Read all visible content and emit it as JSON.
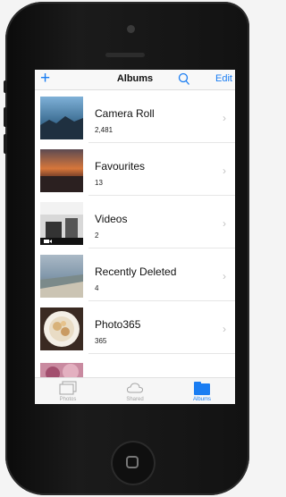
{
  "nav": {
    "add_icon": "plus-icon",
    "title": "Albums",
    "search_icon": "search-icon",
    "edit_label": "Edit"
  },
  "albums": [
    {
      "title": "Camera Roll",
      "count": "2,481"
    },
    {
      "title": "Favourites",
      "count": "13"
    },
    {
      "title": "Videos",
      "count": "2"
    },
    {
      "title": "Recently Deleted",
      "count": "4"
    },
    {
      "title": "Photo365",
      "count": "365"
    }
  ],
  "tabs": [
    {
      "label": "Photos",
      "icon": "photos-icon",
      "active": false
    },
    {
      "label": "Shared",
      "icon": "cloud-icon",
      "active": false
    },
    {
      "label": "Albums",
      "icon": "folder-icon",
      "active": true
    }
  ],
  "colors": {
    "accent": "#1a7df2",
    "inactive": "#a4a4a4"
  }
}
